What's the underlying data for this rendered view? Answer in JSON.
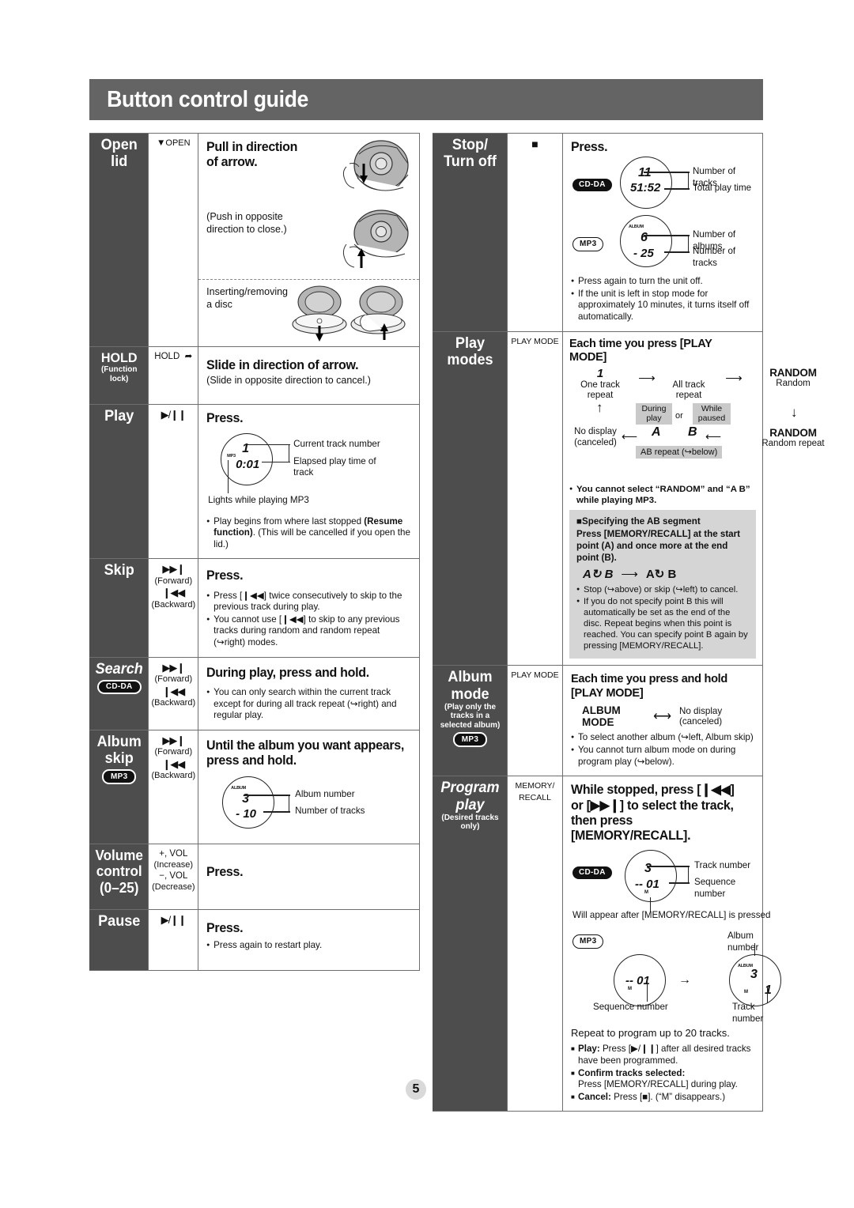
{
  "header": {
    "title": "Button control guide"
  },
  "page_number": "5",
  "badges": {
    "cd_da": "CD-DA",
    "mp3": "MP3"
  },
  "left_rows": [
    {
      "label": "Open lid",
      "button": "OPEN",
      "button_prefix_icon": "triangle-down-icon",
      "heading": "Pull in direction of arrow.",
      "note": "(Push in opposite direction to close.)",
      "image_caption": "Inserting/removing a disc"
    },
    {
      "label": "HOLD",
      "sub_label": "(Function lock)",
      "button": "HOLD",
      "heading": "Slide in direction of arrow.",
      "sub_line": "(Slide in opposite direction to cancel.)"
    },
    {
      "label": "Play",
      "button": "▶/❙❙",
      "heading": "Press.",
      "display": {
        "track": "1",
        "time": "0:01",
        "tag": "MP3",
        "callout_track": "Current track number",
        "callout_time": "Elapsed play time of track",
        "callout_bottom": "Lights while playing MP3"
      },
      "notes": [
        "Play begins from where last stopped (Resume function). (This will be cancelled if you open the lid.)"
      ]
    },
    {
      "label": "Skip",
      "button_forward": "▶▶❙",
      "button_forward_note": "(Forward)",
      "button_backward": "❙◀◀",
      "button_backward_note": "(Backward)",
      "heading": "Press.",
      "notes": [
        "Press [❙◀◀] twice consecutively to skip to the previous track during play.",
        "You cannot use [❙◀◀] to skip to any previous tracks during random and random repeat (↪right) modes."
      ]
    },
    {
      "label": "Search",
      "badge": "CD-DA",
      "button_forward": "▶▶❙",
      "button_forward_note": "(Forward)",
      "button_backward": "❙◀◀",
      "button_backward_note": "(Backward)",
      "heading": "During play, press and hold.",
      "notes": [
        "You can only search within the current track except for during all track repeat (↪right) and regular play."
      ]
    },
    {
      "label": "Album skip",
      "badge": "MP3",
      "button_forward": "▶▶❙",
      "button_forward_note": "(Forward)",
      "button_backward": "❙◀◀",
      "button_backward_note": "(Backward)",
      "heading": "Until the album you want appears, press and hold.",
      "display": {
        "album": "3",
        "tracks": "- 10",
        "tag": "ALBUM",
        "callout_album": "Album number",
        "callout_tracks": "Number of tracks"
      }
    },
    {
      "label": "Volume control (0–25)",
      "button_increase": "+, VOL",
      "button_increase_note": "(Increase)",
      "button_decrease": "−, VOL",
      "button_decrease_note": "(Decrease)",
      "heading": "Press."
    },
    {
      "label": "Pause",
      "button": "▶/❙❙",
      "heading": "Press.",
      "notes": [
        "Press again to restart play."
      ]
    }
  ],
  "right_rows": [
    {
      "label": "Stop/ Turn off",
      "button": "■",
      "heading": "Press.",
      "display_cd": {
        "badge": "CD-DA",
        "tracks": "11",
        "time": "51:52",
        "callout_tracks": "Number of tracks",
        "callout_time": "Total play time"
      },
      "display_mp3": {
        "badge": "MP3",
        "albums": "6",
        "tracks": "- 25",
        "tag": "ALBUM",
        "callout_albums": "Number of albums",
        "callout_tracks": "Number of tracks"
      },
      "notes": [
        "Press again to turn the unit off.",
        "If the unit is left in stop mode for approximately 10 minutes, it turns itself off automatically."
      ]
    },
    {
      "label": "Play modes",
      "button": "PLAY MODE",
      "heading": "Each time you press [PLAY MODE]",
      "flow": {
        "one_track_symbol": "1",
        "one_track_label": "One track repeat",
        "all_track_label": "All track repeat",
        "random_top": "RANDOM",
        "random_top_label": "Random",
        "random_bottom": "RANDOM",
        "random_bottom_label": "Random repeat",
        "no_display": "No display",
        "canceled": "(canceled)",
        "during_play": "During play",
        "or": "or",
        "while_paused": "While paused",
        "a_symbol": "A",
        "b_symbol": "B",
        "ab_repeat": "AB repeat (↪below)"
      },
      "notes": [
        "You cannot select “RANDOM” and “A      B” while playing MP3."
      ],
      "graybox": {
        "title": "■Specifying the AB segment",
        "instruction": "Press [MEMORY/RECALL] at the start point (A) and once more at the end point (B).",
        "diagram_left": "A↻ B",
        "diagram_right": "A↻ B",
        "notes": [
          "Stop (↪above) or skip (↪left) to cancel.",
          "If you do not specify point B this will automatically be set as the end of the disc. Repeat begins when this point is reached. You can specify point B again by pressing [MEMORY/RECALL]."
        ]
      }
    },
    {
      "label": "Album mode",
      "sub_label": "(Play only the tracks in a selected album)",
      "badge": "MP3",
      "button": "PLAY MODE",
      "heading": "Each time you press and hold [PLAY MODE]",
      "toggle_left": "ALBUM MODE",
      "toggle_right": "No display (canceled)",
      "notes": [
        "To select another album (↪left, Album skip)",
        "You cannot turn album mode on during program play (↪below)."
      ]
    },
    {
      "label": "Program play",
      "sub_label": "(Desired tracks only)",
      "button": "MEMORY/ RECALL",
      "heading": "While stopped, press [❙◀◀] or [▶▶❙] to select the track, then press [MEMORY/RECALL].",
      "display_cd": {
        "badge": "CD-DA",
        "track": "3",
        "sequence": "-- 01",
        "mtag": "M",
        "callout_track": "Track number",
        "callout_sequence": "Sequence number",
        "note_below": "Will appear after [MEMORY/RECALL] is pressed"
      },
      "display_mp3": {
        "badge": "MP3",
        "seq_value": "-- 01",
        "seq_label": "Sequence number",
        "album_value": "3",
        "track_value": "1",
        "album_label": "Album number",
        "track_label": "Track number",
        "mtag": "M",
        "arrow": "→"
      },
      "repeat_line": "Repeat to program up to 20 tracks.",
      "notes": [
        "Play: Press [▶/❙❙] after all desired tracks have been programmed.",
        "Confirm tracks selected: Press [MEMORY/RECALL] during play.",
        "Cancel: Press [■]. (“M” disappears.)"
      ]
    }
  ]
}
